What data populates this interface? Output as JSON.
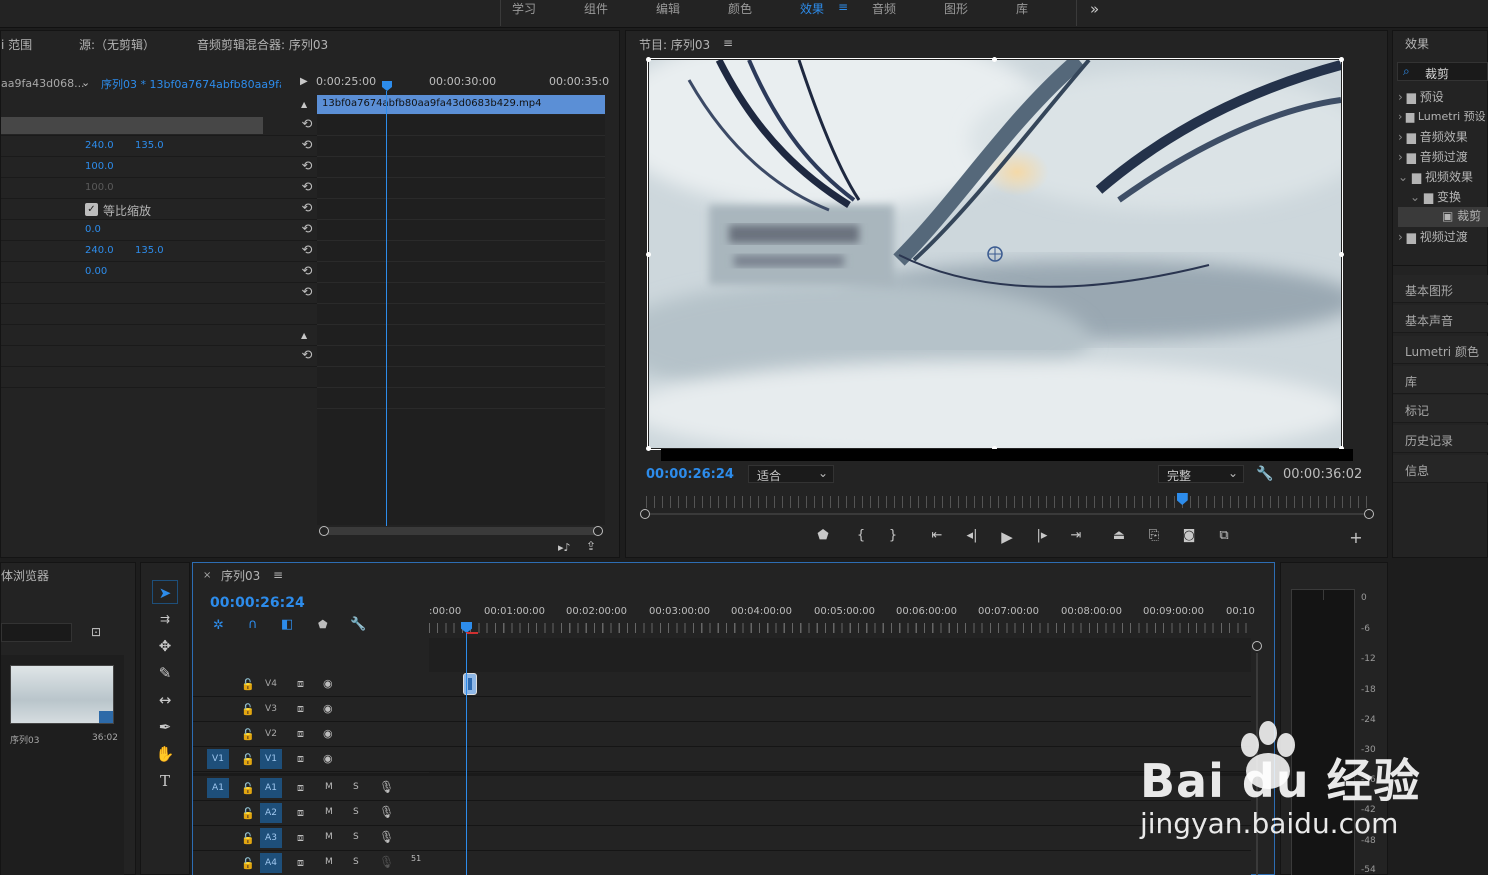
{
  "workspace_tabs": [
    "学习",
    "组件",
    "编辑",
    "颜色",
    "效果",
    "音频",
    "图形",
    "库"
  ],
  "workspace_active": "效果",
  "workspace_more": "»",
  "source_panel": {
    "tabs": [
      "i 范围",
      "源:（无剪辑）",
      "音频剪辑混合器: 序列03"
    ],
    "clip_dropdown": "aa9fa43d068...",
    "sequence_link": "序列03 * 13bf0a7674abfb80aa9fa...",
    "timecodes": [
      "0:00:25:00",
      "00:00:30:00",
      "00:00:35:0"
    ],
    "clip_name": "13bf0a7674abfb80aa9fa43d0683b429.mp4",
    "rows": [
      {
        "v1": "240.0",
        "v2": "135.0"
      },
      {
        "v1": "100.0",
        "v2": ""
      },
      {
        "v1": "100.0",
        "v2": ""
      },
      {
        "checkbox_label": "等比缩放"
      },
      {
        "v1": "0.0",
        "v2": ""
      },
      {
        "v1": "240.0",
        "v2": "135.0"
      },
      {
        "v1": "0.00",
        "v2": ""
      }
    ]
  },
  "program_monitor": {
    "title": "节目: 序列03",
    "timecode": "00:00:26:24",
    "fit": "适合",
    "quality": "完整",
    "duration": "00:00:36:02",
    "playhead_fraction": 0.74
  },
  "effects_panel": {
    "title": "效果",
    "search_value": "裁剪",
    "tree": [
      {
        "label": "预设",
        "level": 0
      },
      {
        "label": "Lumetri 预设",
        "level": 0
      },
      {
        "label": "音频效果",
        "level": 0
      },
      {
        "label": "音频过渡",
        "level": 0
      },
      {
        "label": "视频效果",
        "level": 0
      },
      {
        "label": "变换",
        "level": 1
      },
      {
        "label": "裁剪",
        "level": 2
      },
      {
        "label": "视频过渡",
        "level": 0
      }
    ],
    "panels": [
      "基本图形",
      "基本声音",
      "Lumetri 颜色",
      "库",
      "标记",
      "历史记录",
      "信息"
    ]
  },
  "project_panel": {
    "title": "体浏览器",
    "item_name": "序列03",
    "item_duration": "36:02"
  },
  "timeline": {
    "title": "序列03",
    "timecode": "00:00:26:24",
    "ruler": [
      ":00:00",
      "00:01:00:00",
      "00:02:00:00",
      "00:03:00:00",
      "00:04:00:00",
      "00:05:00:00",
      "00:06:00:00",
      "00:07:00:00",
      "00:08:00:00",
      "00:09:00:00",
      "00:10"
    ],
    "video_tracks": [
      {
        "src": "",
        "name": "V4",
        "target": false
      },
      {
        "src": "",
        "name": "V3",
        "target": false
      },
      {
        "src": "",
        "name": "V2",
        "target": false
      },
      {
        "src": "V1",
        "name": "V1",
        "target": true
      }
    ],
    "audio_tracks": [
      {
        "src": "A1",
        "name": "A1",
        "target": true
      },
      {
        "src": "",
        "name": "A2",
        "target": true
      },
      {
        "src": "",
        "name": "A3",
        "target": true
      },
      {
        "src": "",
        "name": "A4",
        "target": true
      }
    ],
    "m_label": "M",
    "s_label": "S",
    "bottom_num": "51"
  },
  "meter_labels": [
    "0",
    "-6",
    "-12",
    "-18",
    "-24",
    "-30",
    "-36",
    "-42",
    "-48",
    "-54"
  ],
  "watermark": {
    "brand": "Bai du 经验",
    "url": "jingyan.baidu.com"
  }
}
